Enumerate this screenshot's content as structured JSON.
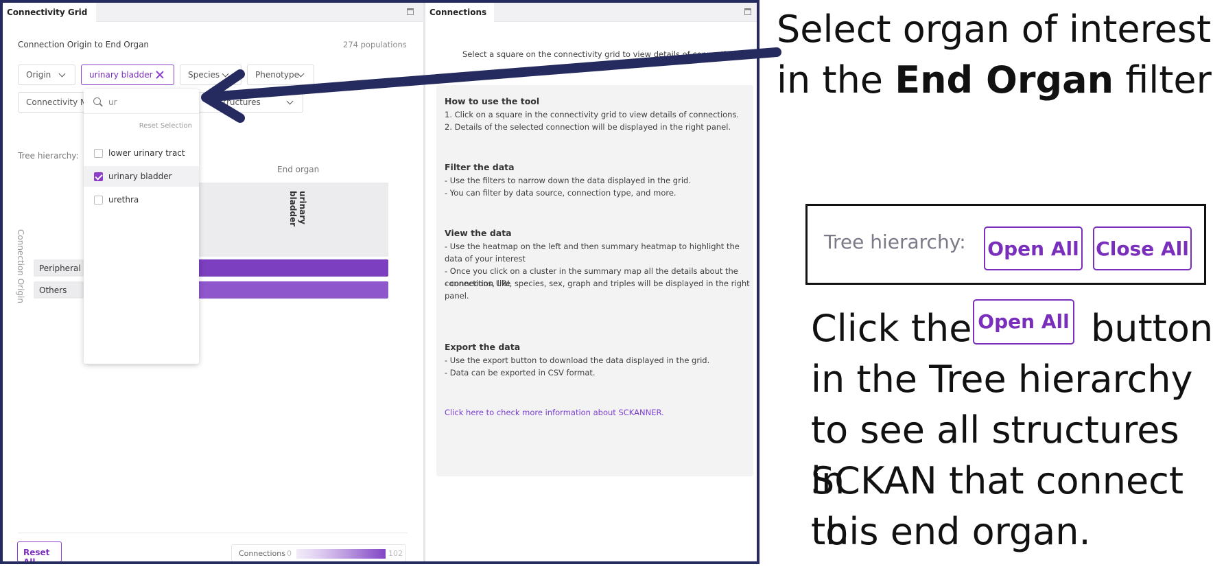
{
  "left_panel": {
    "tab_title": "Connectivity Grid",
    "subtitle": "Connection Origin to End Organ",
    "population_count": "274 populations",
    "filters": {
      "origin": "Origin",
      "end_organ_selected": "urinary bladder",
      "species": "Species",
      "phenotype": "Phenotype",
      "connectivity": "Connectivity M",
      "via": "structures"
    },
    "dropdown": {
      "search_value": "ur",
      "reset_label": "Reset Selection",
      "options": [
        {
          "label": "lower urinary tract",
          "checked": false
        },
        {
          "label": "urinary bladder",
          "checked": true
        },
        {
          "label": "urethra",
          "checked": false
        }
      ]
    },
    "tree_label": "Tree hierarchy:",
    "end_organ_header": "End organ",
    "column_label": "urinary bladder",
    "connection_origin_label": "Connection Origin",
    "rows": [
      {
        "label": "Peripheral",
        "color": "#7b3fc0"
      },
      {
        "label": "Others",
        "color": "#8e57cc"
      }
    ],
    "reset_all": "Reset All",
    "legend": {
      "label": "Connections",
      "min": "0",
      "max": "102"
    }
  },
  "right_panel": {
    "tab_title": "Connections",
    "prompt": "Select a square on the connectivity grid to view details of connections",
    "sections": [
      {
        "title": "How to use the tool",
        "lines": [
          "1. Click on a square in the connectivity grid to view details of connections.",
          "2. Details of the selected connection will be displayed in the right panel."
        ]
      },
      {
        "title": "Filter the data",
        "lines": [
          "- Use the filters to narrow down the data displayed in the grid.",
          "- You can filter by data source, connection type, and more."
        ]
      },
      {
        "title": "View the data",
        "lines": [
          "- Use the heatmap on the left and then summary heatmap to highlight the data of your interest",
          "- Once you click on a cluster in the summary map all the details about the connections, like",
          "- connection URI, species, sex, graph and triples will be displayed in the right panel."
        ]
      },
      {
        "title": "Export the data",
        "lines": [
          "- Use the export button to download the data displayed in the grid.",
          "- Data can be exported in CSV format."
        ]
      }
    ],
    "more_info_link": "Click here to check more information about SCKANNER."
  },
  "annotations": {
    "top_line1": "Select organ of interest",
    "top_line2_prefix": "in the ",
    "top_line2_bold": "End Organ",
    "top_line2_suffix": " filter",
    "callout_tree_label": "Tree hierarchy:",
    "callout_open_all": "Open All",
    "callout_close_all": "Close All",
    "click_prefix": "Click the",
    "click_button": "Open All",
    "click_suffix": "button",
    "line2": "in the Tree hierarchy",
    "line3": "to see all structures in",
    "line4": "SCKAN that connect to",
    "line5": "this end organ.",
    "accent_color": "#7a2fbc",
    "arrow_color": "#262b5f"
  }
}
